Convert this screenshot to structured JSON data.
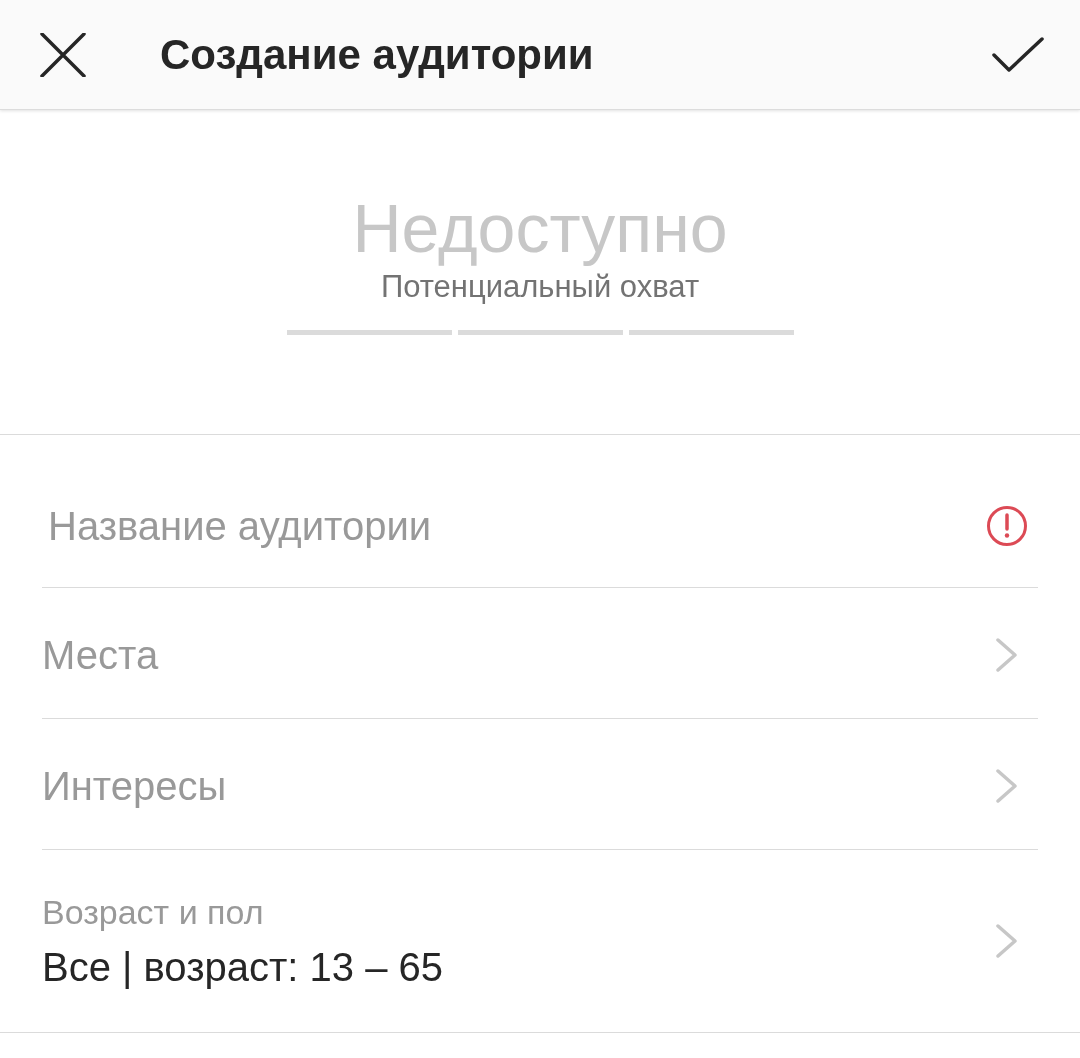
{
  "header": {
    "title": "Создание аудитории"
  },
  "reach": {
    "value": "Недоступно",
    "label": "Потенциальный охват",
    "segments": [
      {
        "filled": false
      },
      {
        "filled": false
      },
      {
        "filled": false
      }
    ]
  },
  "name_field": {
    "placeholder": "Название аудитории",
    "error": true
  },
  "rows": [
    {
      "label": "Места"
    },
    {
      "label": "Интересы"
    },
    {
      "label": "Возраст и пол",
      "value": "Все | возраст: 13 – 65"
    }
  ]
}
